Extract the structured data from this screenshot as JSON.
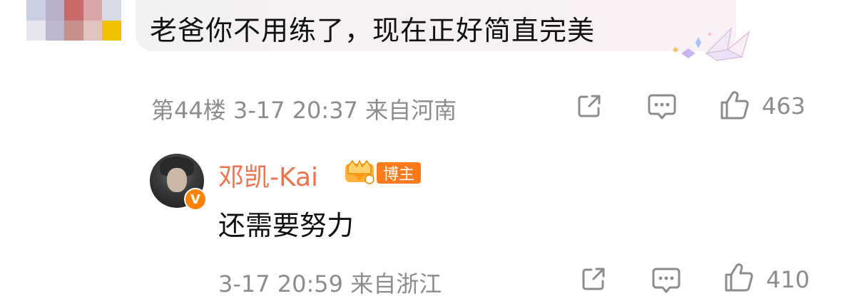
{
  "comment": {
    "text": "老爸你不用练了，现在正好简直完美",
    "floor_meta": "第44楼 3-17 20:37 来自河南",
    "like_count": "463"
  },
  "reply": {
    "username": "邓凯-Kai",
    "badge_label": "博主",
    "verified_mark": "V",
    "text": "还需要努力",
    "meta": "3-17 20:59 来自浙江",
    "like_count": "410"
  },
  "colors": {
    "username": "#eb7350",
    "meta": "#8c8c8c",
    "badge": "#ff7a1a"
  },
  "icons": [
    "share-icon",
    "comment-icon",
    "like-icon"
  ]
}
